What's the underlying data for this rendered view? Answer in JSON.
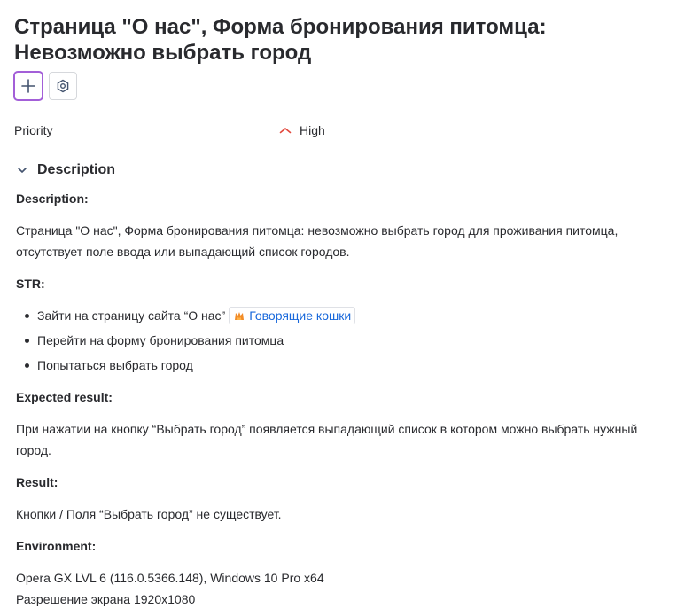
{
  "issue": {
    "title_lines": [
      "Страница \"О нас\", Форма бронирования питомца:",
      "Невозможно выбрать город"
    ]
  },
  "toolbar": {
    "add_icon": "plus-icon",
    "settings_icon": "hexagon-settings-icon",
    "accent_color": "#a35fd8"
  },
  "fields": {
    "priority_label": "Priority",
    "priority_value": "High",
    "priority_icon": "chevron-up-icon",
    "priority_color": "#e2483d"
  },
  "description": {
    "section_title": "Description",
    "heading_description": "Description:",
    "description_text": "Страница \"О нас\", Форма бронирования питомца: невозможно выбрать город для проживания питомца, отсутствует поле ввода или выпадающий список городов.",
    "heading_str": "STR:",
    "str_steps": [
      "Зайти на страницу сайта “О нас”",
      "Перейти на форму бронирования питомца",
      "Попытаться выбрать город"
    ],
    "link_text": "Говорящие кошки",
    "link_icon": "cat-paws-icon",
    "link_color": "#1868db",
    "heading_expected": "Expected result:",
    "expected_text": "При нажатии на кнопку “Выбрать город” появляется выпадающий список в котором можно выбрать нужный город.",
    "heading_result": "Result:",
    "result_text": "Кнопки / Поля “Выбрать город” не существует.",
    "heading_environment": "Environment:",
    "environment_lines": [
      "Opera GX LVL 6 (116.0.5366.148), Windows 10 Pro x64",
      "Разрешение экрана 1920x1080"
    ]
  }
}
